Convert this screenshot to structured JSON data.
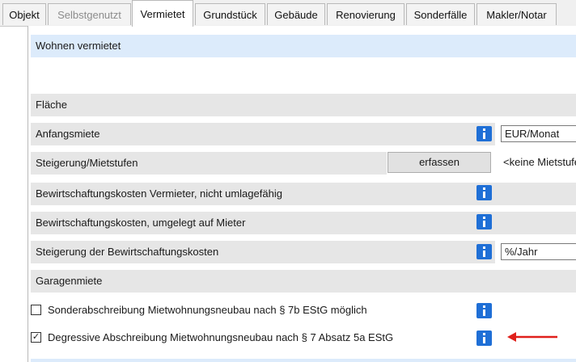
{
  "tabs": [
    {
      "label": "Objekt",
      "state": "normal"
    },
    {
      "label": "Selbstgenutzt",
      "state": "disabled"
    },
    {
      "label": "Vermietet",
      "state": "active"
    },
    {
      "label": "Grundstück",
      "state": "normal"
    },
    {
      "label": "Gebäude",
      "state": "normal"
    },
    {
      "label": "Renovierung",
      "state": "normal"
    },
    {
      "label": "Sonderfälle",
      "state": "normal"
    },
    {
      "label": "Makler/Notar",
      "state": "normal"
    }
  ],
  "section_title": "Wohnen vermietet",
  "rows": {
    "flaeche": "Fläche",
    "anfangsmiete": "Anfangsmiete",
    "steigerung_mietstufen": "Steigerung/Mietstufen",
    "bewirt_vermieter": "Bewirtschaftungskosten Vermieter, nicht umlagefähig",
    "bewirt_mieter": "Bewirtschaftungskosten, umgelegt auf Mieter",
    "steigerung_bewirt": "Steigerung der Bewirtschaftungskosten",
    "garagenmiete": "Garagenmiete"
  },
  "fields": {
    "anfangsmiete_unit": "EUR/Monat",
    "steigerung_unit": "%/Jahr",
    "mietstufen_value": "<keine Mietstufen>"
  },
  "buttons": {
    "erfassen": "erfassen"
  },
  "checkboxes": {
    "sonderabschreibung": {
      "label": "Sonderabschreibung Mietwohnungsneubau nach § 7b EStG möglich",
      "checked": false
    },
    "degressive": {
      "label": "Degressive Abschreibung Mietwohnungsneubau nach § 7 Absatz 5a EStG",
      "checked": true
    }
  },
  "icons": {
    "info": "info-icon",
    "arrow": "red-arrow-left"
  },
  "colors": {
    "info_blue": "#1f6fd6",
    "header_bg": "#dcebfb",
    "row_bg": "#e6e6e6",
    "arrow_red": "#e0201b"
  }
}
